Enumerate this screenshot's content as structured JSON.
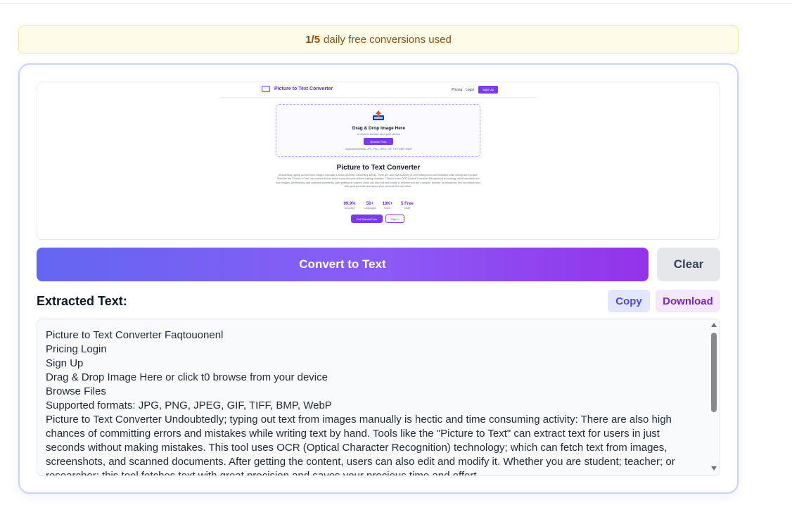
{
  "quota": {
    "count": "1/5",
    "text": "daily free conversions used"
  },
  "preview": {
    "brand": "Picture to Text Converter",
    "nav_pricing": "Pricing",
    "nav_login": "Login",
    "nav_signup": "Sign Up",
    "drop_title": "Drag & Drop Image Here",
    "drop_sub": "or click to browse from your device",
    "browse": "Browse Files",
    "formats": "Supported formats: JPG, PNG, JPEG, GIF, TIFF, BMP, WebP",
    "heading": "Picture to Text Converter",
    "paragraph": "Undoubtedly, typing out text from images manually is hectic and time consuming activity. There are also high chances of committing errors and mistakes while writing text by hand. Tools like the \"Picture to Text\" can extract text for users in just seconds without making mistakes. This tool uses OCR (Optical Character Recognition) technology, which can fetch text from images, screenshots, and scanned documents. After getting the content, users can also edit and modify it. Whether you are a student, teacher, or researcher, this tool fetches text with great precision and saves your precious time and effort.",
    "stats": [
      {
        "value": "99.9%",
        "label": "Accuracy"
      },
      {
        "value": "50+",
        "label": "Languages"
      },
      {
        "value": "10K+",
        "label": "Users"
      },
      {
        "value": "5 Free",
        "label": "Daily"
      }
    ],
    "cta_primary": "Get Started Free",
    "cta_secondary": "Sign In"
  },
  "actions": {
    "convert": "Convert to Text",
    "clear": "Clear",
    "copy": "Copy",
    "download": "Download"
  },
  "result": {
    "heading": "Extracted Text:",
    "text": "Picture to Text Converter Faqtouonenl\nPricing Login\nSign Up\nDrag & Drop Image Here or click t0 browse from your device\nBrowse Files\nSupported formats: JPG, PNG, JPEG, GIF, TIFF, BMP, WebP\nPicture to Text Converter Undoubtedly; typing out text from images manually is hectic and time consuming activity: There are also high chances of committing errors and mistakes while writing text by hand. Tools like the \"Picture to Text\" can extract text for users in just seconds without making mistakes. This tool uses OCR (Optical Character Recognition) technology; which can fetch text from images, screenshots, and scanned documents. After getting the content, users can also edit and modify it. Whether you are student; teacher; or researcher; this tool fetches text with great precision and saves your precious time and effort."
  },
  "colors": {
    "accent": "#7c3aed",
    "gradient_start": "#6366f1",
    "gradient_end": "#9333ea",
    "banner_bg": "#fefce8"
  }
}
